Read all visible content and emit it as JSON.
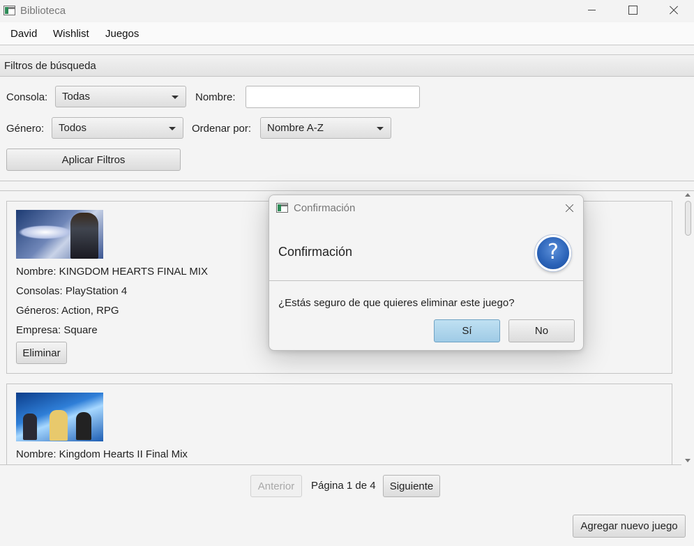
{
  "window": {
    "title": "Biblioteca"
  },
  "menu": {
    "items": [
      "David",
      "Wishlist",
      "Juegos"
    ]
  },
  "filters": {
    "header": "Filtros de búsqueda",
    "console_label": "Consola:",
    "console_value": "Todas",
    "name_label": "Nombre:",
    "name_value": "",
    "genre_label": "Género:",
    "genre_value": "Todos",
    "sort_label": "Ordenar por:",
    "sort_value": "Nombre A-Z",
    "apply_button": "Aplicar Filtros"
  },
  "games": [
    {
      "name": "Nombre: KINGDOM HEARTS FINAL MIX",
      "consoles": "Consolas: PlayStation 4",
      "genres": "Géneros: Action, RPG",
      "company": "Empresa: Square",
      "delete_button": "Eliminar"
    },
    {
      "name": "Nombre: Kingdom Hearts II Final Mix"
    }
  ],
  "pagination": {
    "prev": "Anterior",
    "page_text": "Página 1 de 4",
    "next": "Siguiente"
  },
  "add_button": "Agregar nuevo juego",
  "dialog": {
    "title": "Confirmación",
    "header": "Confirmación",
    "icon": "question-icon",
    "icon_glyph": "?",
    "message": "¿Estás seguro de que quieres eliminar este juego?",
    "yes": "Sí",
    "no": "No",
    "accent": "#2a62b7"
  }
}
